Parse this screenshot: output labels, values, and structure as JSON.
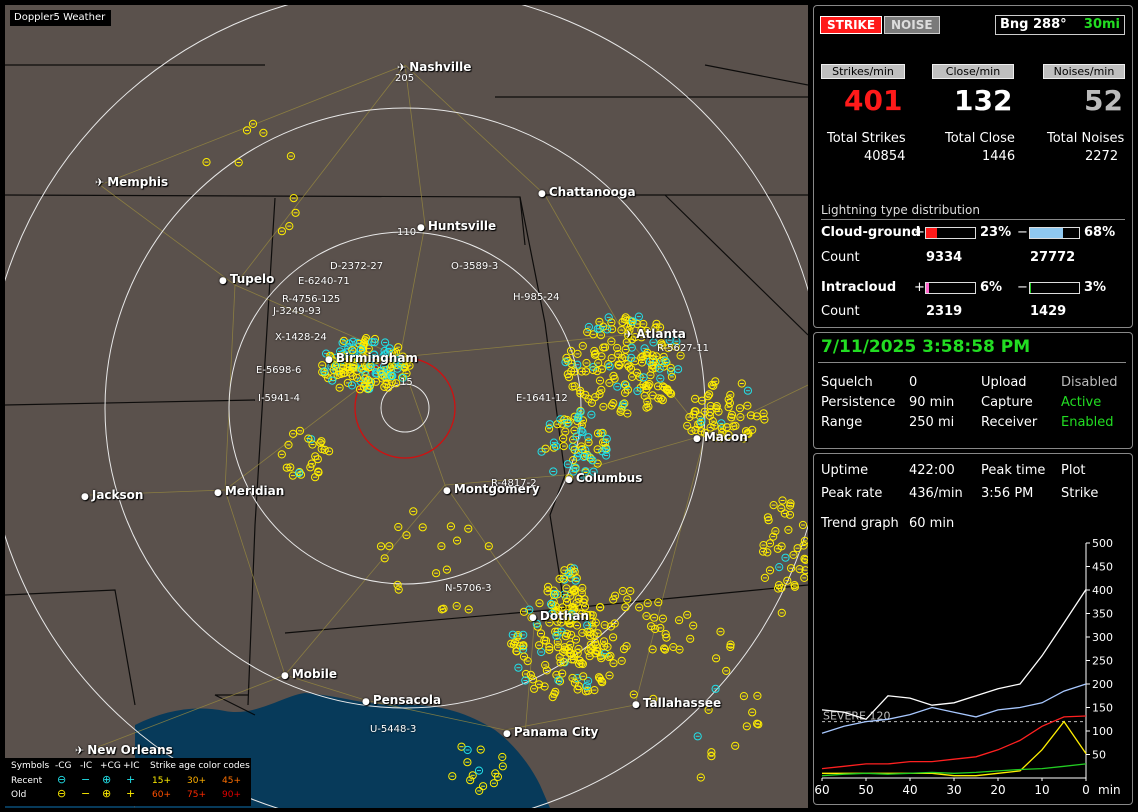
{
  "window_title": "Doppler5 Weather",
  "map": {
    "cities": [
      {
        "name": "Nashville",
        "icon": "airport-icon"
      },
      {
        "name": "Memphis",
        "icon": "airport-icon"
      },
      {
        "name": "Chattanooga",
        "icon": "dot-icon"
      },
      {
        "name": "Huntsville",
        "icon": "dot-icon"
      },
      {
        "name": "Tupelo",
        "icon": "dot-icon"
      },
      {
        "name": "Birmingham",
        "icon": "dot-icon"
      },
      {
        "name": "Atlanta",
        "icon": "airport-icon"
      },
      {
        "name": "Macon",
        "icon": "dot-icon"
      },
      {
        "name": "Columbus",
        "icon": "dot-icon"
      },
      {
        "name": "Montgomery",
        "icon": "dot-icon"
      },
      {
        "name": "Meridian",
        "icon": "dot-icon"
      },
      {
        "name": "Jackson",
        "icon": "dot-icon"
      },
      {
        "name": "Dothan",
        "icon": "dot-icon"
      },
      {
        "name": "Mobile",
        "icon": "dot-icon"
      },
      {
        "name": "Pensacola",
        "icon": "dot-icon"
      },
      {
        "name": "Tallahassee",
        "icon": "dot-icon"
      },
      {
        "name": "Panama City",
        "icon": "dot-icon"
      },
      {
        "name": "New Orleans",
        "icon": "airport-icon"
      }
    ],
    "range_labels": [
      "205",
      "110",
      "15"
    ],
    "sensors": [
      "D-2372-27",
      "E-6240-71",
      "R-4756-125",
      "J-3249-93",
      "X-1428-24",
      "E-5698-6",
      "I-5941-4",
      "O-3589-3",
      "H-985-24",
      "R-5627-11",
      "E-1641-12",
      "R-4817-2",
      "N-5706-3",
      "U-5448-3"
    ]
  },
  "legend": {
    "symbols_label": "Symbols",
    "types": [
      "-CG",
      "-IC",
      "+CG",
      "+IC"
    ],
    "age_title": "Strike age color codes",
    "recent_label": "Recent",
    "old_label": "Old",
    "recent_ages": [
      "15+",
      "30+",
      "45+"
    ],
    "old_ages": [
      "60+",
      "75+",
      "90+"
    ]
  },
  "status": {
    "strike_button": "STRIKE",
    "noise_button": "NOISE",
    "bearing": "Bng 288°",
    "distance": "30mi"
  },
  "rates": {
    "strikes_header": "Strikes/min",
    "close_header": "Close/min",
    "noises_header": "Noises/min",
    "strikes_value": "401",
    "close_value": "132",
    "noises_value": "52",
    "total_strikes_label": "Total Strikes",
    "total_close_label": "Total Close",
    "total_noises_label": "Total Noises",
    "total_strikes": "40854",
    "total_close": "1446",
    "total_noises": "2272"
  },
  "distribution": {
    "title": "Lightning type distribution",
    "cg_label": "Cloud-ground",
    "ic_label": "Intracloud",
    "count_label": "Count",
    "plus": "+",
    "minus": "−",
    "cg_pos_pct": "23%",
    "cg_neg_pct": "68%",
    "cg_pos_count": "9334",
    "cg_neg_count": "27772",
    "ic_pos_pct": "6%",
    "ic_neg_pct": "3%",
    "ic_pos_count": "2319",
    "ic_neg_count": "1429",
    "cg_pos_fill": 0.23,
    "cg_neg_fill": 0.68,
    "ic_pos_fill": 0.06,
    "ic_neg_fill": 0.03
  },
  "settings": {
    "datetime": "7/11/2025 3:58:58 PM",
    "squelch_label": "Squelch",
    "squelch": "0",
    "persistence_label": "Persistence",
    "persistence": "90 min",
    "range_label": "Range",
    "range": "250 mi",
    "upload_label": "Upload",
    "upload": "Disabled",
    "capture_label": "Capture",
    "capture": "Active",
    "receiver_label": "Receiver",
    "receiver": "Enabled"
  },
  "stats": {
    "uptime_label": "Uptime",
    "uptime": "422:00",
    "peak_time_label": "Peak time",
    "peak_time": "3:56 PM",
    "plot_label": "Plot",
    "plot": "Strike",
    "peak_rate_label": "Peak rate",
    "peak_rate": "436/min",
    "trend_label": "Trend graph",
    "trend": "60 min"
  },
  "colors": {
    "strike_red": "#ff1a1a",
    "active_green": "#22dd22",
    "cg_neg_blue": "#8fc8f0",
    "ic_pos_pink": "#ff66cc",
    "ic_neg_green": "#22cc22",
    "strike_yellow": "#ffee00",
    "strike_cyan": "#22e0e8"
  },
  "chart_data": {
    "type": "line",
    "x": [
      60,
      55,
      50,
      45,
      40,
      35,
      30,
      25,
      20,
      15,
      10,
      5,
      0
    ],
    "xlabel": "min",
    "x_ticks": [
      "60",
      "50",
      "40",
      "30",
      "20",
      "10",
      "0"
    ],
    "y_ticks": [
      "500",
      "450",
      "400",
      "350",
      "300",
      "250",
      "200",
      "150",
      "100",
      "50"
    ],
    "ylim": [
      0,
      500
    ],
    "threshold": {
      "label": "SEVERE 120",
      "value": 120
    },
    "series": [
      {
        "color": "#ffffff",
        "values": [
          145,
          140,
          125,
          175,
          170,
          155,
          160,
          175,
          190,
          200,
          260,
          330,
          401
        ]
      },
      {
        "color": "#a8c8ff",
        "values": [
          95,
          110,
          120,
          125,
          135,
          150,
          140,
          130,
          145,
          150,
          160,
          185,
          200
        ]
      },
      {
        "color": "#ff2020",
        "values": [
          20,
          25,
          30,
          30,
          35,
          35,
          40,
          45,
          60,
          80,
          110,
          130,
          132
        ]
      },
      {
        "color": "#ffee00",
        "values": [
          10,
          10,
          10,
          10,
          10,
          10,
          5,
          5,
          10,
          15,
          60,
          120,
          52
        ]
      },
      {
        "color": "#22cc22",
        "values": [
          5,
          8,
          10,
          8,
          10,
          12,
          10,
          12,
          15,
          18,
          20,
          25,
          30
        ]
      }
    ]
  }
}
